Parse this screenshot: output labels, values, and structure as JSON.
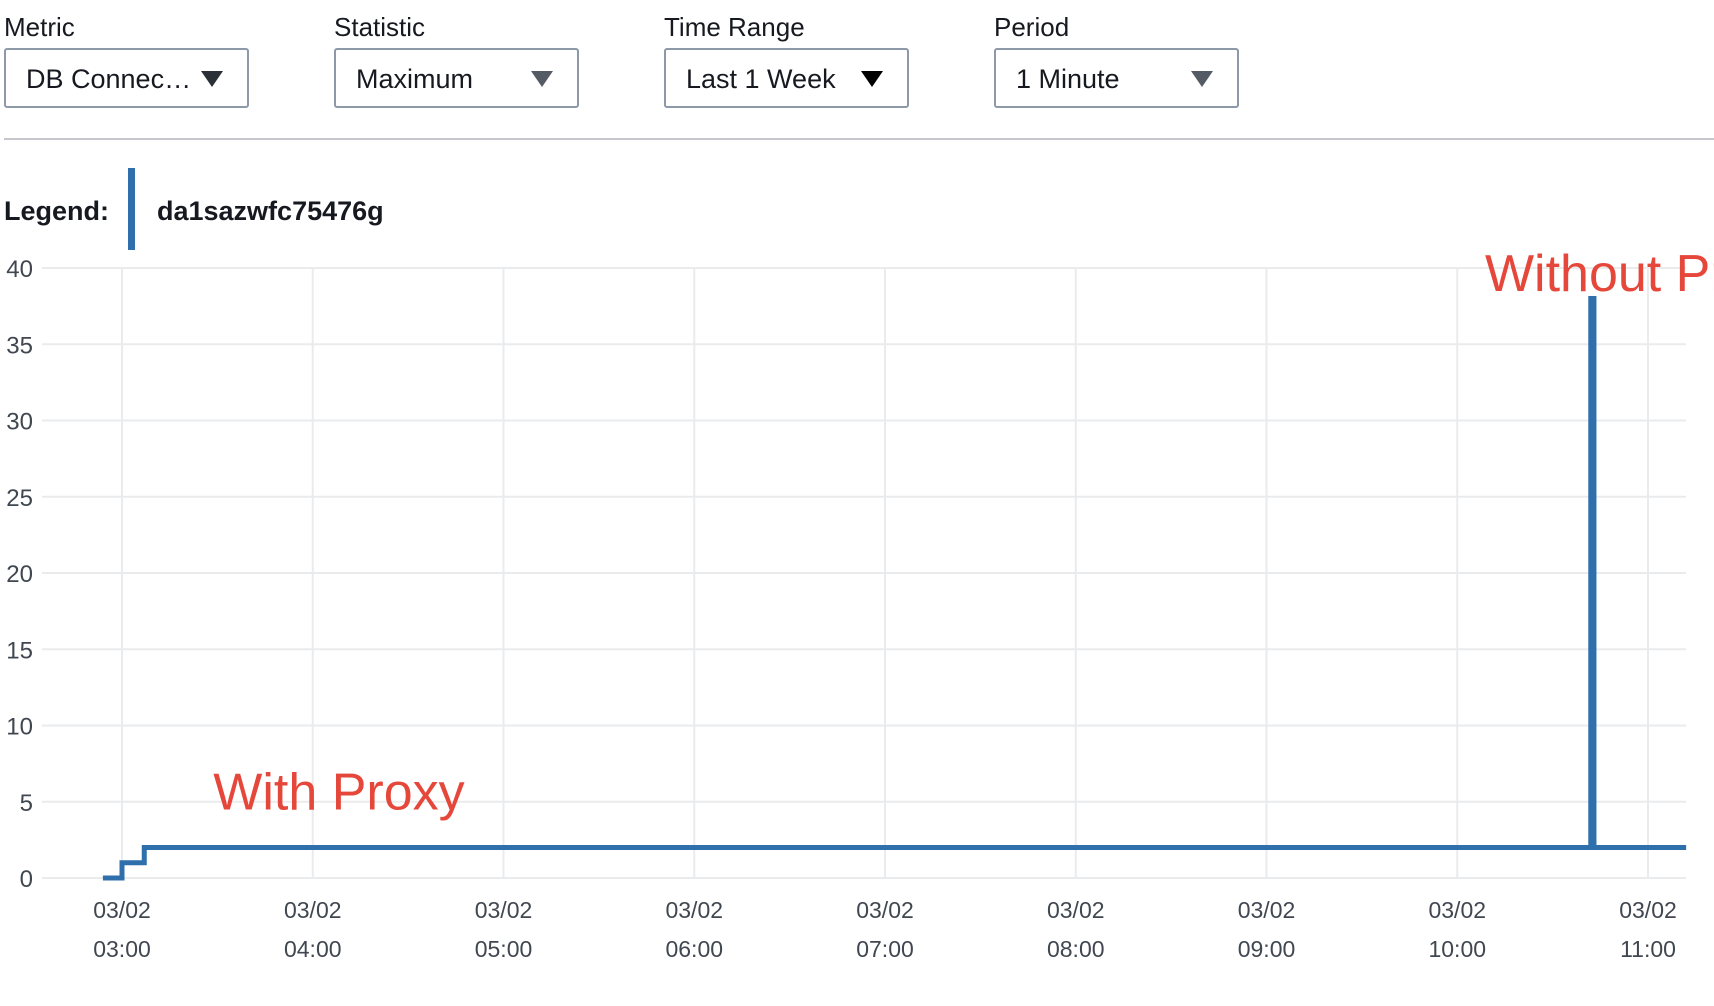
{
  "controls": [
    {
      "label": "Metric",
      "value": "DB Connec…",
      "caret": "black-grey"
    },
    {
      "label": "Statistic",
      "value": "Maximum",
      "caret": "grey"
    },
    {
      "label": "Time Range",
      "value": "Last 1 Week",
      "caret": "black"
    },
    {
      "label": "Period",
      "value": "1 Minute",
      "caret": "grey"
    }
  ],
  "legend": {
    "label": "Legend:",
    "series": "da1sazwfc75476g",
    "color": "#2e6fac"
  },
  "chart_data": {
    "type": "line",
    "step": true,
    "ylim": [
      0,
      40
    ],
    "yticks": [
      0,
      5,
      10,
      15,
      20,
      25,
      30,
      35,
      40
    ],
    "xticks": [
      {
        "date": "03/02",
        "time": "03:00"
      },
      {
        "date": "03/02",
        "time": "04:00"
      },
      {
        "date": "03/02",
        "time": "05:00"
      },
      {
        "date": "03/02",
        "time": "06:00"
      },
      {
        "date": "03/02",
        "time": "07:00"
      },
      {
        "date": "03/02",
        "time": "08:00"
      },
      {
        "date": "03/02",
        "time": "09:00"
      },
      {
        "date": "03/02",
        "time": "10:00"
      },
      {
        "date": "03/02",
        "time": "11:00"
      }
    ],
    "series": [
      {
        "name": "da1sazwfc75476g",
        "color": "#2e6fac",
        "points": [
          {
            "t": "02:54",
            "y": 0
          },
          {
            "t": "03:00",
            "y": 1
          },
          {
            "t": "03:07",
            "y": 2
          },
          {
            "t": "10:42",
            "y": 38
          },
          {
            "t": "10:43",
            "y": 2
          },
          {
            "t": "11:12",
            "y": 2
          }
        ]
      }
    ],
    "annotations": [
      {
        "text": "With Proxy",
        "at_t": "03:35",
        "at_y": 4.5,
        "color": "#e5473a"
      },
      {
        "text": "Without Proxy",
        "at_t": "10:15",
        "at_y": 38.5,
        "color": "#e5473a"
      }
    ],
    "grid": true
  }
}
